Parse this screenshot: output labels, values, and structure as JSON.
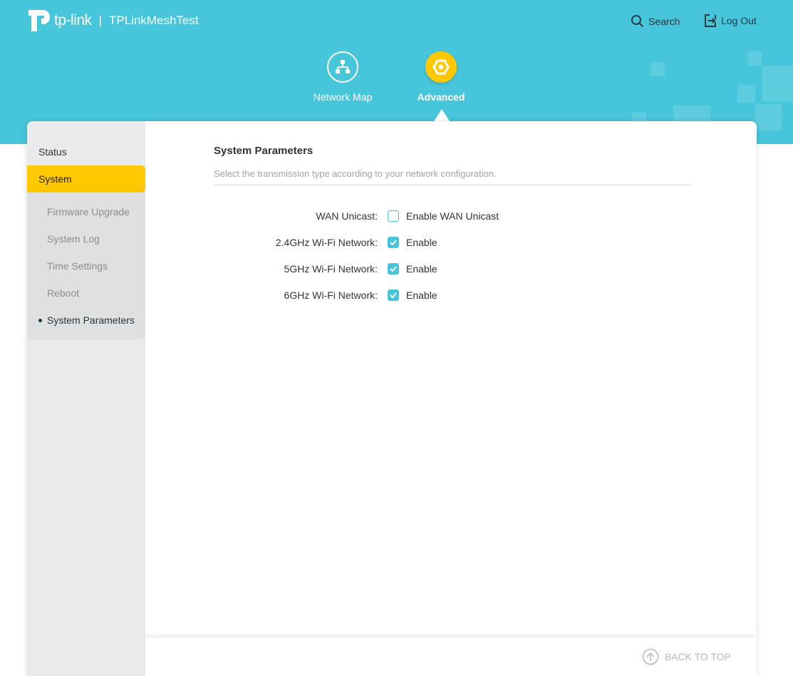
{
  "header": {
    "brand": "tp-link",
    "separator": "|",
    "device_name": "TPLinkMeshTest",
    "search_label": "Search",
    "logout_label": "Log Out"
  },
  "nav": [
    {
      "label": "Network Map"
    },
    {
      "label": "Advanced"
    }
  ],
  "sidebar": {
    "items": [
      {
        "label": "Status"
      },
      {
        "label": "System"
      }
    ],
    "subitems": [
      {
        "label": "Firmware Upgrade"
      },
      {
        "label": "System Log"
      },
      {
        "label": "Time Settings"
      },
      {
        "label": "Reboot"
      },
      {
        "label": "System Parameters"
      }
    ]
  },
  "main": {
    "title": "System Parameters",
    "description": "Select the transmission type according to your network configuration.",
    "rows": [
      {
        "label": "WAN Unicast:",
        "option": "Enable WAN Unicast",
        "checked": false
      },
      {
        "label": "2.4GHz Wi-Fi Network:",
        "option": "Enable",
        "checked": true
      },
      {
        "label": "5GHz Wi-Fi Network:",
        "option": "Enable",
        "checked": true
      },
      {
        "label": "6GHz Wi-Fi Network:",
        "option": "Enable",
        "checked": true
      }
    ]
  },
  "footer": {
    "back_to_top": "BACK TO TOP"
  },
  "colors": {
    "header": "#47C5DA",
    "accent": "#FFC800"
  }
}
